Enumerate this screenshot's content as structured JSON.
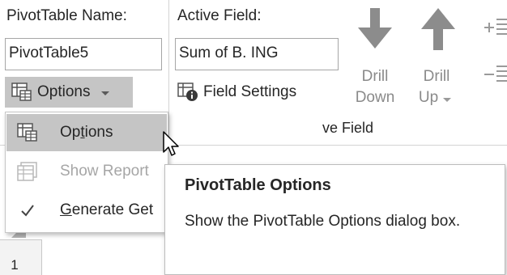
{
  "pivot": {
    "name_label": "PivotTable Name:",
    "name_value": "PivotTable5",
    "options_button": "Options"
  },
  "active_field": {
    "label": "Active Field:",
    "value": "Sum of B. ING",
    "field_settings": "Field Settings",
    "drill_down_line1": "Drill",
    "drill_down_line2": "Down",
    "drill_up_line1": "Drill",
    "drill_up_line2": "Up",
    "group_label_visible": "ve Field"
  },
  "menu": {
    "items": [
      {
        "label_pre": "Op",
        "label_ul": "t",
        "label_post": "ions",
        "icon": "options-icon",
        "state": "hover"
      },
      {
        "label_pre": "",
        "label_ul": "",
        "label_post": "Show Report",
        "icon": "report-filter-icon",
        "state": "disabled"
      },
      {
        "label_pre": "",
        "label_ul": "G",
        "label_post": "enerate Get",
        "icon": "checkmark-icon",
        "state": "normal"
      }
    ]
  },
  "tooltip": {
    "title": "PivotTable Options",
    "body": "Show the PivotTable Options dialog box."
  },
  "sheet": {
    "row_number": "1"
  },
  "colors": {
    "hover": "#c5c5c5",
    "arrow_grey": "#8c8c8c",
    "disabled_text": "#a6a6a6"
  }
}
